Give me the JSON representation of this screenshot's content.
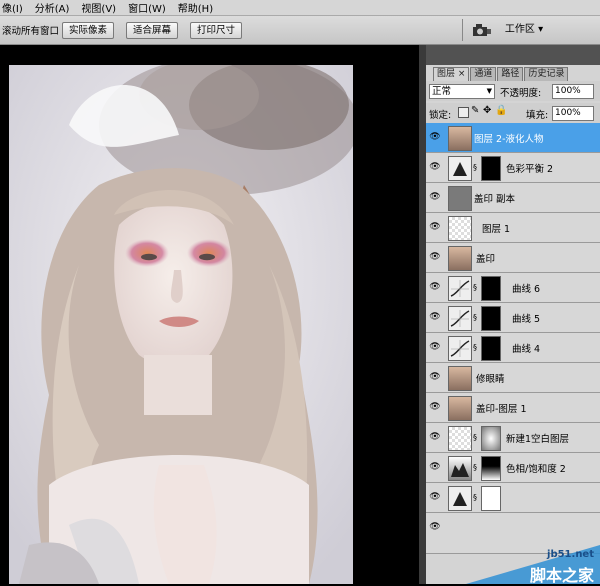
{
  "menubar": {
    "items": [
      {
        "key": "Y",
        "label": "像(I)"
      },
      {
        "key": "A",
        "label": "分析(A)"
      },
      {
        "key": "V",
        "label": "视图(V)"
      },
      {
        "key": "W",
        "label": "窗口(W)"
      },
      {
        "key": "H",
        "label": "帮助(H)"
      }
    ]
  },
  "options_bar": {
    "all_windows_label": "滚动所有窗口",
    "actual_pixels": "实际像素",
    "fit_screen": "适合屏幕",
    "print_size": "打印尺寸",
    "workspace_label": "工作区 ▾"
  },
  "panel": {
    "tabs": [
      "图层 ×",
      "通道",
      "路径",
      "历史记录"
    ],
    "blend_mode": "正常",
    "opacity_label": "不透明度:",
    "opacity_value": "100%",
    "lock_label": "锁定:",
    "fill_label": "填充:",
    "fill_value": "100%"
  },
  "layers": [
    {
      "name": "图层 2-液化人物",
      "selected": true
    },
    {
      "name": "色彩平衡 2",
      "selected": false
    },
    {
      "name": "盖印 副本",
      "selected": false
    },
    {
      "name": "图层 1",
      "selected": false
    },
    {
      "name": "盖印",
      "selected": false
    },
    {
      "name": "曲线 6",
      "selected": false
    },
    {
      "name": "曲线 5",
      "selected": false
    },
    {
      "name": "曲线 4",
      "selected": false
    },
    {
      "name": "修眼睛",
      "selected": false
    },
    {
      "name": "盖印-图层 1",
      "selected": false
    },
    {
      "name": "新建1空白图层",
      "selected": false
    },
    {
      "name": "色相/饱和度 2",
      "selected": false
    },
    {
      "name": "",
      "selected": false
    },
    {
      "name": "",
      "selected": false
    }
  ],
  "watermark": {
    "url": "jb51.net",
    "site": "脚本之家"
  },
  "colors": {
    "selected_row": "#4aa0e8",
    "panel_bg": "#d4d4d4",
    "canvas_bg": "#000000"
  }
}
